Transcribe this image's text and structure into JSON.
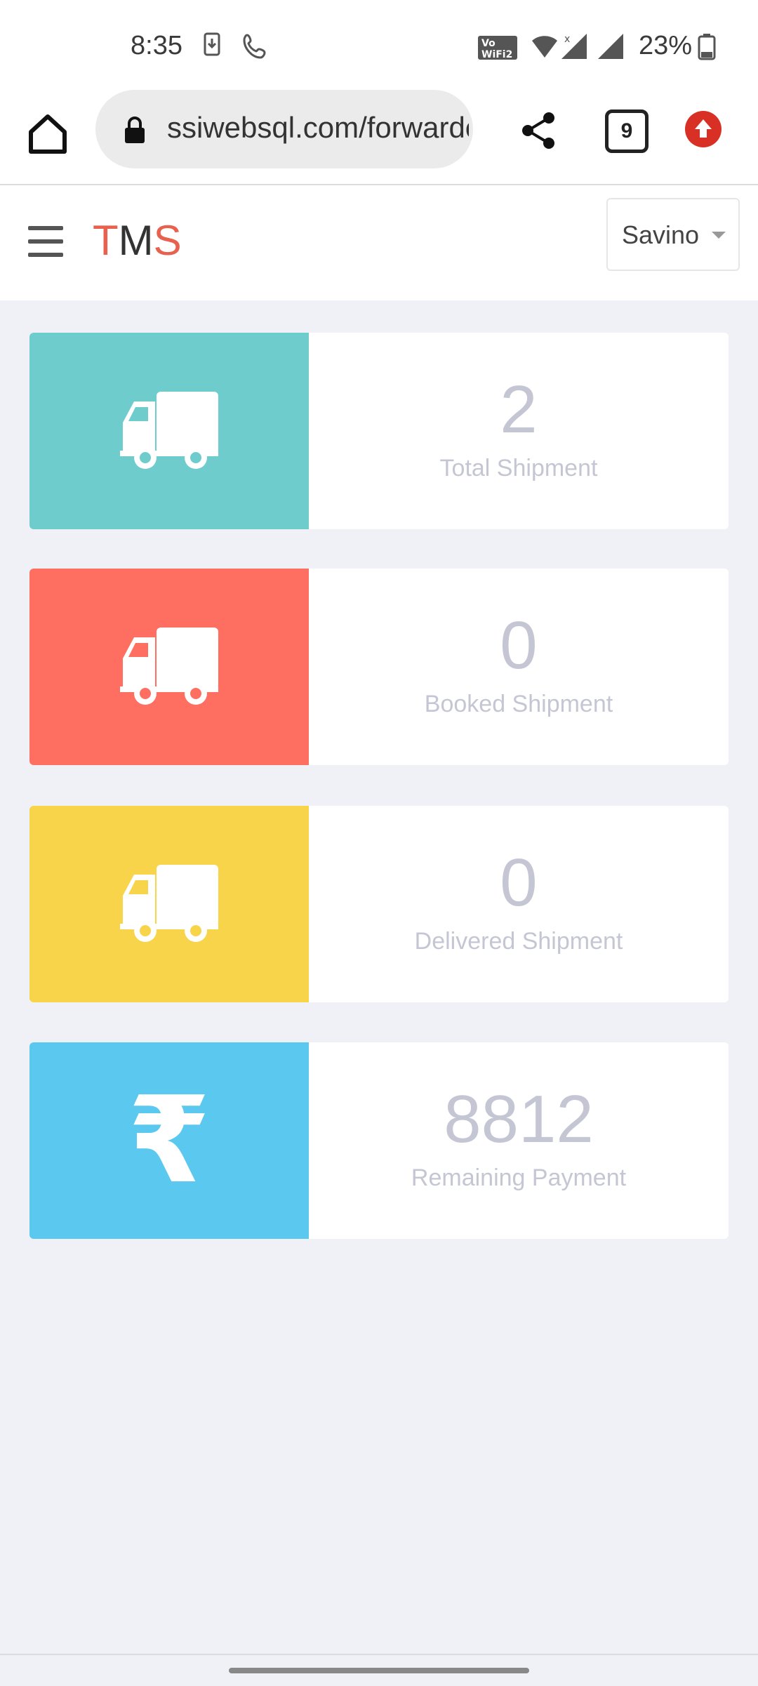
{
  "status_bar": {
    "time": "8:35",
    "battery": "23%"
  },
  "browser": {
    "url": "ssiwebsql.com/forwarder/dashboard",
    "tab_count": "9",
    "update_color": "#d93025"
  },
  "app": {
    "logo": [
      "T",
      "M",
      "S"
    ],
    "logo_colors": [
      "#e8614f",
      "#333333",
      "#e8614f"
    ],
    "user": "Savino"
  },
  "cards": [
    {
      "value": "2",
      "label": "Total Shipment",
      "color": "#6fcccc",
      "icon": "truck-icon"
    },
    {
      "value": "0",
      "label": "Booked Shipment",
      "color": "#fe6f62",
      "icon": "truck-icon"
    },
    {
      "value": "0",
      "label": "Delivered Shipment",
      "color": "#f8d44b",
      "icon": "truck-icon"
    },
    {
      "value": "8812",
      "label": "Remaining Payment",
      "color": "#5bc8f0",
      "icon": "rupee-icon",
      "symbol": "₹"
    }
  ]
}
